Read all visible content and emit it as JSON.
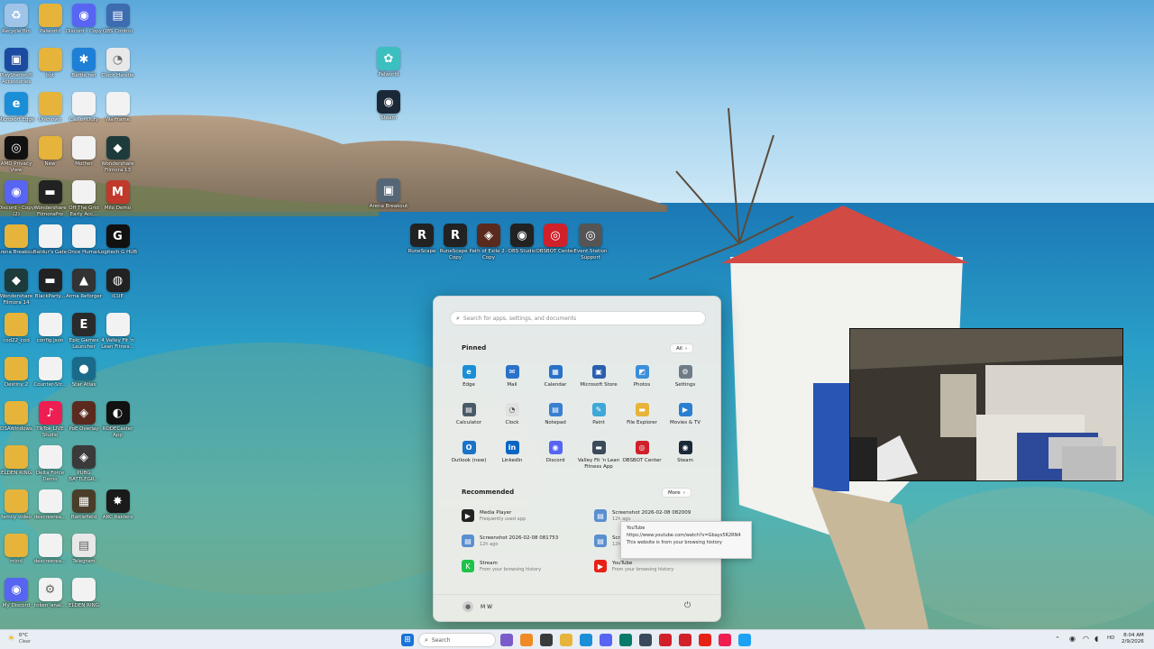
{
  "desktop": {
    "icons": [
      {
        "label": "Recycle Bin",
        "color": "#9fc4e8",
        "glyph": "♻"
      },
      {
        "label": "Palworld",
        "color": "#e6b43a",
        "glyph": ""
      },
      {
        "label": "Discord - Copy",
        "color": "#5865f2",
        "glyph": "◉"
      },
      {
        "label": "OBS Control",
        "color": "#3d6cb0",
        "glyph": "▤"
      },
      {
        "label": "PlayStation® Accessories",
        "color": "#1b4ba0",
        "glyph": "▣"
      },
      {
        "label": "bot",
        "color": "#e6b43a",
        "glyph": ""
      },
      {
        "label": "Battle.net",
        "color": "#1e7fd6",
        "glyph": "✱"
      },
      {
        "label": "Clock Handle",
        "color": "#e8e8e8",
        "glyph": "◔"
      },
      {
        "label": "Microsoft Edge",
        "color": "#1a8fd8",
        "glyph": "e"
      },
      {
        "label": "Unknown",
        "color": "#e6b43a",
        "glyph": ""
      },
      {
        "label": "Call of Duty",
        "color": "#f2f2f2",
        "glyph": ""
      },
      {
        "label": "Warframe",
        "color": "#f2f2f2",
        "glyph": ""
      },
      {
        "label": "AMD Privacy View",
        "color": "#111111",
        "glyph": "◎"
      },
      {
        "label": "New",
        "color": "#e6b43a",
        "glyph": ""
      },
      {
        "label": "Mother",
        "color": "#f2f2f2",
        "glyph": ""
      },
      {
        "label": "Wondershare Filmora 13",
        "color": "#1d3b3a",
        "glyph": "◆"
      },
      {
        "label": "Discord - Copy (2)",
        "color": "#5865f2",
        "glyph": "◉"
      },
      {
        "label": "Wondershare FilmoraPro",
        "color": "#222222",
        "glyph": "▬"
      },
      {
        "label": "Off The Grid Early Acc...",
        "color": "#f2f2f2",
        "glyph": ""
      },
      {
        "label": "Milo Demo",
        "color": "#c0392b",
        "glyph": "M"
      },
      {
        "label": "Arena Breakout",
        "color": "#e6b43a",
        "glyph": ""
      },
      {
        "label": "Baldur's Gate",
        "color": "#f2f2f2",
        "glyph": ""
      },
      {
        "label": "Once Human",
        "color": "#f2f2f2",
        "glyph": ""
      },
      {
        "label": "Logitech G HUB",
        "color": "#111111",
        "glyph": "G"
      },
      {
        "label": "Wondershare Filmora 14",
        "color": "#1d3b3a",
        "glyph": "◆"
      },
      {
        "label": "BlackParty...",
        "color": "#222222",
        "glyph": "▬"
      },
      {
        "label": "Arma Reforger",
        "color": "#333333",
        "glyph": "▲"
      },
      {
        "label": "iCUE",
        "color": "#222222",
        "glyph": "◍"
      },
      {
        "label": "cod22_cod",
        "color": "#e6b43a",
        "glyph": ""
      },
      {
        "label": "config.json",
        "color": "#f2f2f2",
        "glyph": ""
      },
      {
        "label": "Epic Games Launcher",
        "color": "#2a2a2a",
        "glyph": "E"
      },
      {
        "label": "4 Valley Fit 'n Lean Fitnes...",
        "color": "#f2f2f2",
        "glyph": ""
      },
      {
        "label": "Destiny 2",
        "color": "#e6b43a",
        "glyph": ""
      },
      {
        "label": "Counter-Str...",
        "color": "#f2f2f2",
        "glyph": ""
      },
      {
        "label": "Star Atlas",
        "color": "#1a6a8a",
        "glyph": "●"
      },
      {
        "label": "DSAWindows",
        "color": "#e6b43a",
        "glyph": ""
      },
      {
        "label": "TikTok LIVE Studio",
        "color": "#ee1d52",
        "glyph": "♪"
      },
      {
        "label": "PoE Overlay",
        "color": "#5b2a1e",
        "glyph": "◈"
      },
      {
        "label": "RODECaster App",
        "color": "#111111",
        "glyph": "◐"
      },
      {
        "label": "ELDEN RING",
        "color": "#e6b43a",
        "glyph": ""
      },
      {
        "label": "Delta Force Demo",
        "color": "#f2f2f2",
        "glyph": ""
      },
      {
        "label": "PUBG BATTLEGR...",
        "color": "#3a3a3a",
        "glyph": "◈"
      },
      {
        "label": "family video",
        "color": "#e6b43a",
        "glyph": ""
      },
      {
        "label": "descreerea...",
        "color": "#f2f2f2",
        "glyph": ""
      },
      {
        "label": "Battlefield",
        "color": "#4a3d2a",
        "glyph": "▦"
      },
      {
        "label": "ARC Raiders",
        "color": "#1a1a1a",
        "glyph": "✸"
      },
      {
        "label": "mind",
        "color": "#e6b43a",
        "glyph": ""
      },
      {
        "label": "descreerea...",
        "color": "#f2f2f2",
        "glyph": ""
      },
      {
        "label": "Telegram",
        "color": "#e8e8e8",
        "glyph": "▤"
      },
      {
        "label": "My Discord",
        "color": "#5865f2",
        "glyph": "◉"
      },
      {
        "label": "token_anal...",
        "color": "#f2f2f2",
        "glyph": "⚙"
      },
      {
        "label": "ELDEN RING",
        "color": "#f2f2f2",
        "glyph": ""
      },
      {
        "label": "Palworld",
        "color": "#3cbfbf",
        "glyph": "✿"
      },
      {
        "label": "Steam",
        "color": "#1b2838",
        "glyph": "◉"
      },
      {
        "label": "Arena Breakout",
        "color": "#556677",
        "glyph": "▣"
      },
      {
        "label": "RuneScape",
        "color": "#222222",
        "glyph": "R"
      },
      {
        "label": "RuneScape - Copy",
        "color": "#222222",
        "glyph": "R"
      },
      {
        "label": "Path of Exile 2 - Copy",
        "color": "#5b2a1e",
        "glyph": "◈"
      },
      {
        "label": "OBS Studio",
        "color": "#222222",
        "glyph": "◉"
      },
      {
        "label": "OBSBOT Center",
        "color": "#d0202a",
        "glyph": "◎"
      },
      {
        "label": "Event Station Support",
        "color": "#555555",
        "glyph": "◎"
      }
    ]
  },
  "start_menu": {
    "search_placeholder": "Search for apps, settings, and documents",
    "pinned_title": "Pinned",
    "all_button": "All",
    "pinned_apps": [
      {
        "label": "Edge",
        "color": "#1a8fd8",
        "glyph": "e"
      },
      {
        "label": "Mail",
        "color": "#2a72c8",
        "glyph": "✉"
      },
      {
        "label": "Calendar",
        "color": "#2a72c8",
        "glyph": "▦"
      },
      {
        "label": "Microsoft Store",
        "color": "#2a5fb0",
        "glyph": "▣"
      },
      {
        "label": "Photos",
        "color": "#3b8fd8",
        "glyph": "◩"
      },
      {
        "label": "Settings",
        "color": "#6f7c88",
        "glyph": "⚙"
      },
      {
        "label": "Calculator",
        "color": "#4a5a66",
        "glyph": "▤"
      },
      {
        "label": "Clock",
        "color": "#e0e0e0",
        "glyph": "◔"
      },
      {
        "label": "Notepad",
        "color": "#3a7fd0",
        "glyph": "▤"
      },
      {
        "label": "Paint",
        "color": "#3fa8d8",
        "glyph": "✎"
      },
      {
        "label": "File Explorer",
        "color": "#e6b43a",
        "glyph": "▬"
      },
      {
        "label": "Movies & TV",
        "color": "#2a7fd0",
        "glyph": "▶"
      },
      {
        "label": "Outlook (new)",
        "color": "#1a73c8",
        "glyph": "O"
      },
      {
        "label": "LinkedIn",
        "color": "#0a66c2",
        "glyph": "in"
      },
      {
        "label": "Discord",
        "color": "#5865f2",
        "glyph": "◉"
      },
      {
        "label": "Valley Fit 'n Lean Fitness App",
        "color": "#3a4a5a",
        "glyph": "▬"
      },
      {
        "label": "OBSBOT Center",
        "color": "#d0202a",
        "glyph": "◎"
      },
      {
        "label": "Steam",
        "color": "#1b2838",
        "glyph": "◉"
      }
    ],
    "recommended_title": "Recommended",
    "more_button": "More",
    "recommended": [
      {
        "title": "Media Player",
        "sub": "Frequently used app",
        "color": "#222222",
        "glyph": "▶"
      },
      {
        "title": "Screenshot 2026-02-08 082009",
        "sub": "12h ago",
        "color": "#5a8fd0",
        "glyph": "▤"
      },
      {
        "title": "Screenshot 2026-02-08 081753",
        "sub": "12h ago",
        "color": "#5a8fd0",
        "glyph": "▤"
      },
      {
        "title": "Screenshot 2026-02-08 ...",
        "sub": "12h ago",
        "color": "#5a8fd0",
        "glyph": "▤"
      },
      {
        "title": "Stream",
        "sub": "From your browsing history",
        "color": "#1ec34a",
        "glyph": "K"
      },
      {
        "title": "YouTube",
        "sub": "From your browsing history",
        "color": "#e62117",
        "glyph": "▶"
      }
    ],
    "tooltip": {
      "title": "YouTube",
      "url": "https://www.youtube.com/watch?v=Gbays5R2RN4",
      "note": "This website is from your browsing history"
    },
    "user_name": "M W"
  },
  "taskbar": {
    "search_label": "Search",
    "weather_temp": "0°C",
    "weather_desc": "Clear",
    "time": "8:04 AM",
    "date": "2/9/2026",
    "lang": "HD"
  }
}
